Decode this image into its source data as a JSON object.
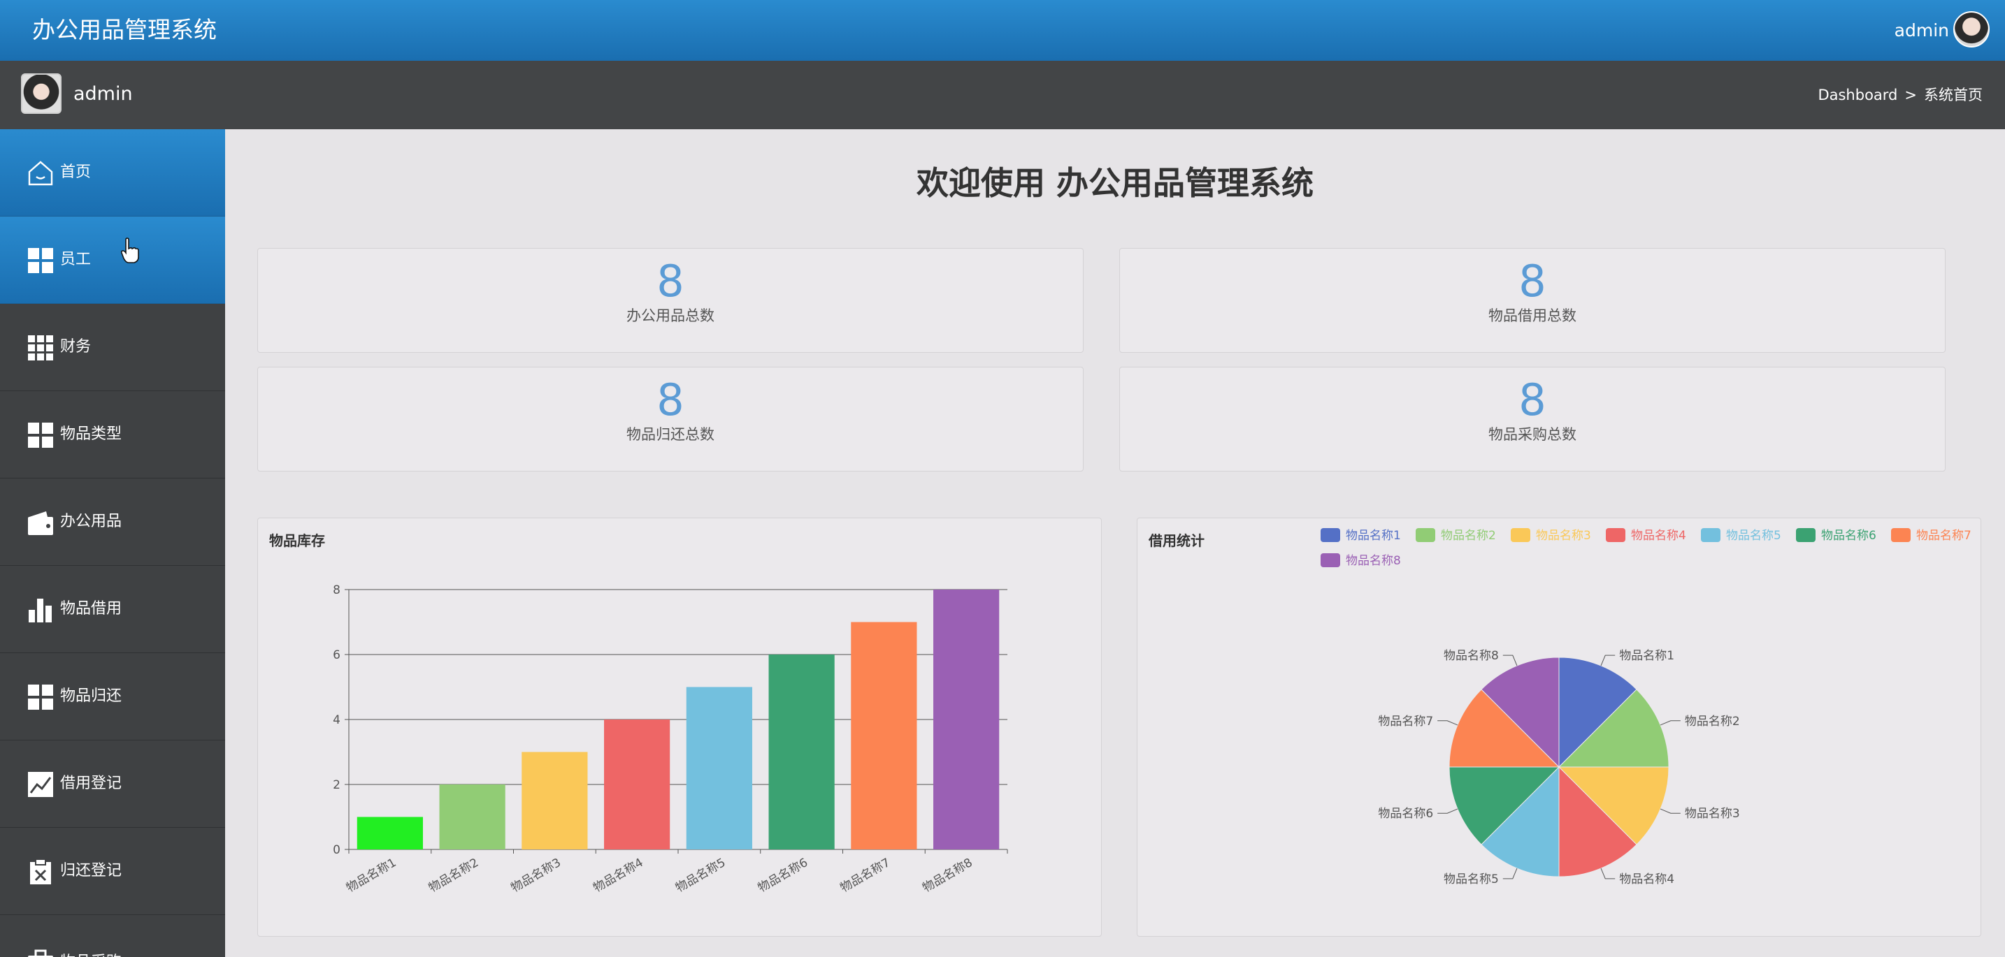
{
  "app": {
    "title": "办公用品管理系统",
    "user": "admin"
  },
  "subbar": {
    "user": "admin",
    "breadcrumb": [
      "Dashboard",
      ">",
      "系统首页"
    ]
  },
  "sidebar": {
    "items": [
      {
        "label": "首页",
        "icon": "home-icon",
        "active": true
      },
      {
        "label": "员工",
        "icon": "grid-icon",
        "active": true
      },
      {
        "label": "财务",
        "icon": "apps-icon",
        "active": false
      },
      {
        "label": "物品类型",
        "icon": "grid-icon",
        "active": false
      },
      {
        "label": "办公用品",
        "icon": "wallet-icon",
        "active": false
      },
      {
        "label": "物品借用",
        "icon": "bar-chart-icon",
        "active": false
      },
      {
        "label": "物品归还",
        "icon": "grid-icon",
        "active": false
      },
      {
        "label": "借用登记",
        "icon": "line-chart-icon",
        "active": false
      },
      {
        "label": "归还登记",
        "icon": "clipboard-x-icon",
        "active": false
      },
      {
        "label": "物品采购",
        "icon": "briefcase-icon",
        "active": false
      }
    ]
  },
  "main": {
    "welcome": "欢迎使用 办公用品管理系统",
    "stats": [
      {
        "value": "8",
        "label": "办公用品总数"
      },
      {
        "value": "8",
        "label": "物品借用总数"
      },
      {
        "value": "8",
        "label": "物品归还总数"
      },
      {
        "value": "8",
        "label": "物品采购总数"
      }
    ]
  },
  "colors": {
    "accent": "#1f7ac0",
    "stat_number": "#5b9bd5",
    "series": [
      "#5470c6",
      "#91cc75",
      "#fac858",
      "#ee6666",
      "#73c0de",
      "#3ba272",
      "#fc8452",
      "#9a60b4"
    ],
    "first_bar": "#22ee22"
  },
  "chart_data": [
    {
      "type": "bar",
      "title": "物品库存",
      "categories": [
        "物品名称1",
        "物品名称2",
        "物品名称3",
        "物品名称4",
        "物品名称5",
        "物品名称6",
        "物品名称7",
        "物品名称8"
      ],
      "values": [
        1,
        2,
        3,
        4,
        5,
        6,
        7,
        8
      ],
      "ylim": [
        0,
        8
      ],
      "yticks": [
        "0",
        "2",
        "4",
        "6",
        "8"
      ],
      "grid": true
    },
    {
      "type": "pie",
      "title": "借用统计",
      "labels": [
        "物品名称1",
        "物品名称2",
        "物品名称3",
        "物品名称4",
        "物品名称5",
        "物品名称6",
        "物品名称7",
        "物品名称8"
      ],
      "values": [
        1,
        1,
        1,
        1,
        1,
        1,
        1,
        1
      ],
      "legend": "top-right"
    }
  ]
}
